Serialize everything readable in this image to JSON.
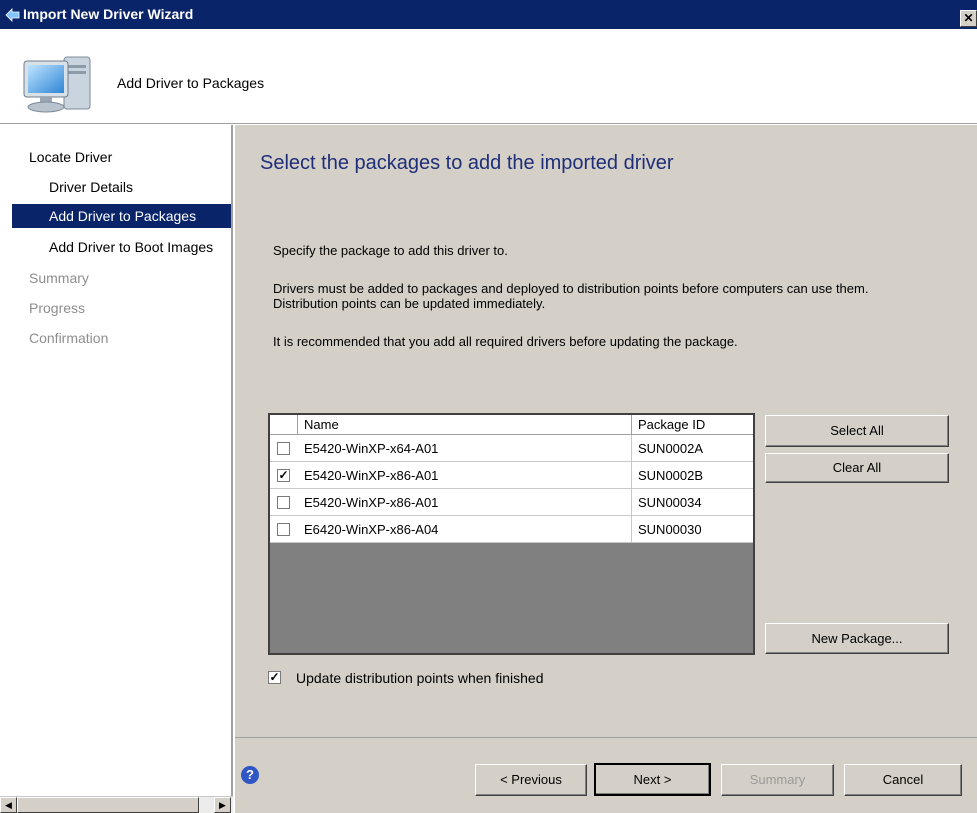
{
  "window": {
    "title": "Import New Driver Wizard",
    "close_glyph": "✕"
  },
  "header": {
    "title": "Add Driver to Packages",
    "icon": "computer-icon"
  },
  "sidebar": {
    "items": [
      {
        "label": "Locate Driver",
        "state": "enabled"
      },
      {
        "label": "Driver Details",
        "state": "enabled"
      },
      {
        "label": "Add Driver to Packages",
        "state": "selected"
      },
      {
        "label": "Add Driver to Boot Images",
        "state": "enabled"
      },
      {
        "label": "Summary",
        "state": "disabled"
      },
      {
        "label": "Progress",
        "state": "disabled"
      },
      {
        "label": "Confirmation",
        "state": "disabled"
      }
    ],
    "scroll_left": "◀",
    "scroll_right": "▶"
  },
  "main": {
    "heading": "Select the packages to add the imported driver",
    "instruction": "Specify the package to add this driver to.",
    "info_line1": "Drivers must be added to packages and deployed to distribution points before computers can use them.",
    "info_line2": "Distribution points can be updated immediately.",
    "recommendation": "It is recommended that you add all required drivers before updating the package."
  },
  "package_table": {
    "columns": [
      "Name",
      "Package ID"
    ],
    "rows": [
      {
        "name": "E5420-WinXP-x64-A01",
        "package_id": "SUN0002A",
        "checked": false
      },
      {
        "name": "E5420-WinXP-x86-A01",
        "package_id": "SUN0002B",
        "checked": true
      },
      {
        "name": "E5420-WinXP-x86-A01",
        "package_id": "SUN00034",
        "checked": false
      },
      {
        "name": "E6420-WinXP-x86-A04",
        "package_id": "SUN00030",
        "checked": false
      }
    ]
  },
  "side_buttons": {
    "select_all": "Select All",
    "clear_all": "Clear All",
    "new_package": "New Package..."
  },
  "update_checkbox": {
    "label": "Update distribution points when finished",
    "checked": true,
    "check_glyph": "✓"
  },
  "footer": {
    "help_glyph": "?",
    "previous": "< Previous",
    "next": "Next >",
    "summary": "Summary",
    "cancel": "Cancel"
  },
  "colors": {
    "titlebar": "#0a246a",
    "selection": "#0a246a",
    "heading": "#1f2e78",
    "dialog_face": "#d4d0c8"
  }
}
